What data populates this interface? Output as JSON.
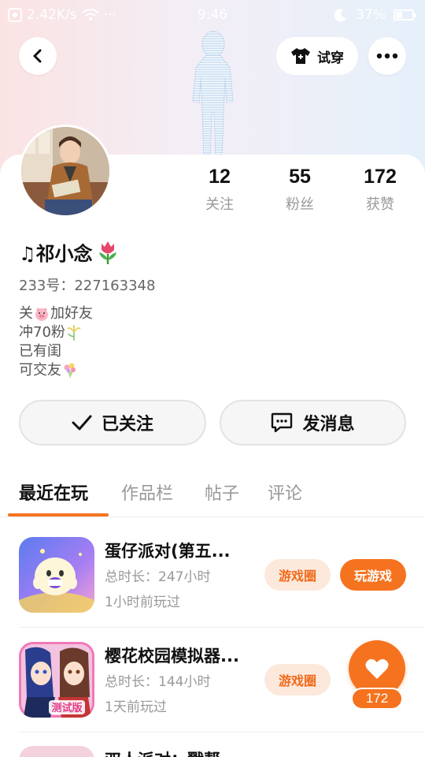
{
  "status_bar": {
    "speed": "2.42K/s",
    "dots": "···",
    "time": "9:46",
    "battery": "37%",
    "battery_level": 0.37
  },
  "header": {
    "try_on_label": "试穿"
  },
  "profile": {
    "stats": [
      {
        "value": "12",
        "label": "关注"
      },
      {
        "value": "55",
        "label": "粉丝"
      },
      {
        "value": "172",
        "label": "获赞"
      }
    ],
    "name": "♫祁小念",
    "uid": "233号：227163348",
    "bio_lines": [
      "关",
      "加好友",
      "冲70粉",
      "已有闺",
      "可交友"
    ]
  },
  "actions": {
    "following_label": "已关注",
    "message_label": "发消息"
  },
  "tabs": [
    {
      "label": "最近在玩",
      "active": true
    },
    {
      "label": "作品栏",
      "active": false
    },
    {
      "label": "帖子",
      "active": false
    },
    {
      "label": "评论",
      "active": false
    }
  ],
  "games": [
    {
      "title": "蛋仔派对(第五...",
      "duration": "总时长：247小时",
      "last_played": "1小时前玩过",
      "circle_label": "游戏圈",
      "play_label": "玩游戏"
    },
    {
      "title": "樱花校园模拟器...",
      "duration": "总时长：144小时",
      "last_played": "1天前玩过",
      "circle_label": "游戏圈",
      "icon_text": "测试版"
    },
    {
      "title": "双人派对：戳帮"
    }
  ],
  "like_widget": {
    "count": "172"
  },
  "colors": {
    "accent": "#f5731f",
    "accent_light": "#fde8dc"
  }
}
